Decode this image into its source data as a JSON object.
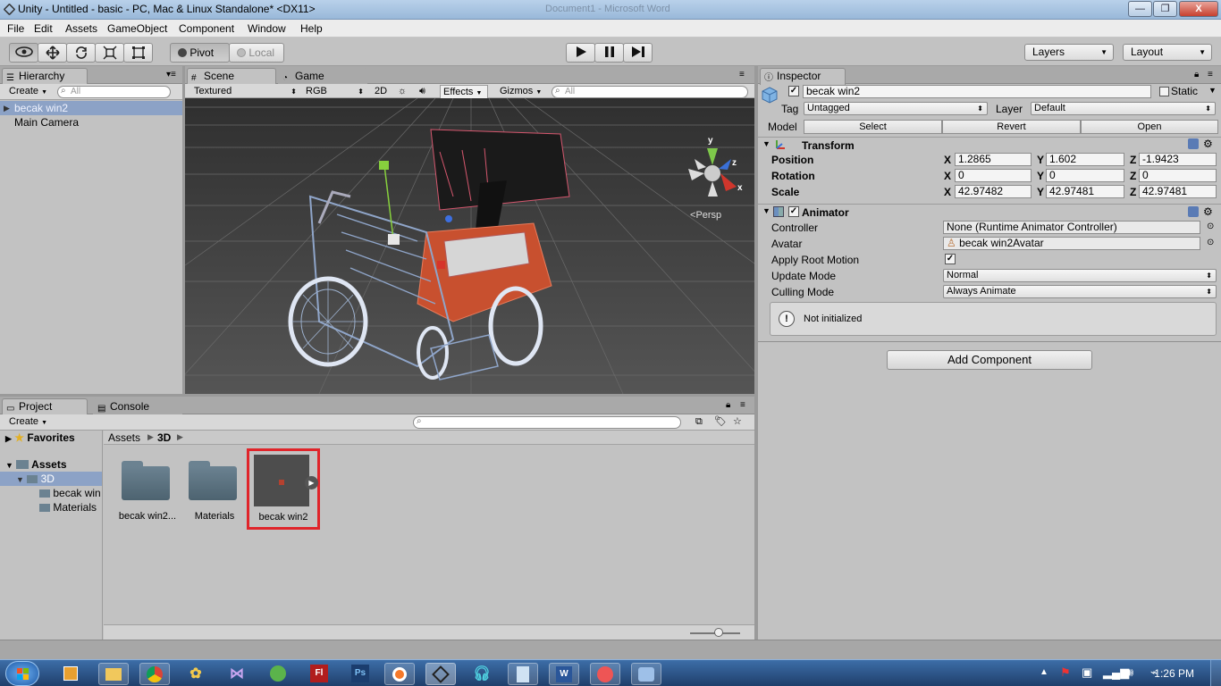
{
  "window": {
    "title": "Unity - Untitled - basic - PC, Mac & Linux Standalone* <DX11>",
    "background_title": "Document1 - Microsoft Word",
    "minimize": "—",
    "maximize": "❐",
    "close": "X"
  },
  "menu": [
    "File",
    "Edit",
    "Assets",
    "GameObject",
    "Component",
    "Window",
    "Help"
  ],
  "toolbar": {
    "pivot": "Pivot",
    "local": "Local",
    "layers": "Layers",
    "layout": "Layout"
  },
  "hierarchy": {
    "tab": "Hierarchy",
    "create": "Create",
    "search_placeholder": "All",
    "items": [
      {
        "label": "becak win2",
        "selected": true
      },
      {
        "label": "Main Camera",
        "selected": false
      }
    ]
  },
  "scene": {
    "tabs": [
      "Scene",
      "Game"
    ],
    "shading": "Textured",
    "render": "RGB",
    "mode2d": "2D",
    "effects": "Effects",
    "gizmos": "Gizmos",
    "search_placeholder": "All",
    "persp": "Persp",
    "axis": {
      "y": "y",
      "z": "z",
      "x": "x"
    }
  },
  "inspector": {
    "tab": "Inspector",
    "object_name": "becak win2",
    "static": "Static",
    "tag_label": "Tag",
    "tag_value": "Untagged",
    "layer_label": "Layer",
    "layer_value": "Default",
    "model_label": "Model",
    "model_buttons": [
      "Select",
      "Revert",
      "Open"
    ],
    "transform": {
      "title": "Transform",
      "position_label": "Position",
      "rotation_label": "Rotation",
      "scale_label": "Scale",
      "position": {
        "x": "1.2865",
        "y": "1.602",
        "z": "-1.9423"
      },
      "rotation": {
        "x": "0",
        "y": "0",
        "z": "0"
      },
      "scale": {
        "x": "42.97482",
        "y": "42.97481",
        "z": "42.97481"
      }
    },
    "animator": {
      "title": "Animator",
      "controller_label": "Controller",
      "controller_value": "None (Runtime Animator Controller)",
      "avatar_label": "Avatar",
      "avatar_value": "becak win2Avatar",
      "root_motion_label": "Apply Root Motion",
      "update_mode_label": "Update Mode",
      "update_mode_value": "Normal",
      "culling_mode_label": "Culling Mode",
      "culling_mode_value": "Always Animate",
      "message": "Not initialized"
    },
    "add_component": "Add Component"
  },
  "project": {
    "tabs": [
      "Project",
      "Console"
    ],
    "create": "Create",
    "favorites": "Favorites",
    "assets": "Assets",
    "tree": [
      "3D",
      "becak win",
      "Materials"
    ],
    "breadcrumb": [
      "Assets",
      "3D"
    ],
    "items": [
      "becak win2...",
      "Materials",
      "becak win2"
    ]
  },
  "taskbar": {
    "time": "1:26 PM",
    "apps": [
      "Fl",
      "Ps"
    ]
  }
}
